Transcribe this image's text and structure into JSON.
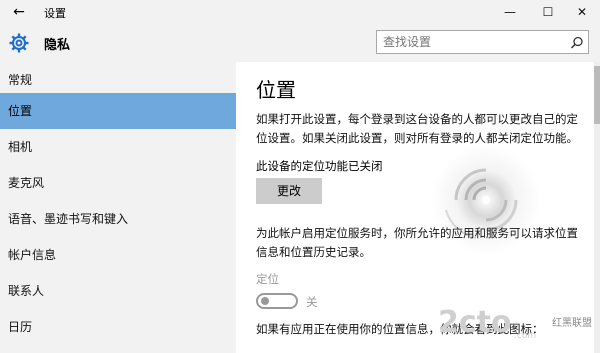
{
  "window": {
    "title": "设置",
    "back_icon": "back-arrow-icon",
    "controls": [
      "minimize-icon",
      "maximize-icon",
      "close-icon"
    ]
  },
  "header": {
    "section_title": "隐私",
    "search_placeholder": "查找设置"
  },
  "sidebar": {
    "items": [
      {
        "label": "常规",
        "active": false
      },
      {
        "label": "位置",
        "active": true
      },
      {
        "label": "相机",
        "active": false
      },
      {
        "label": "麦克风",
        "active": false
      },
      {
        "label": "语音、墨迹书写和键入",
        "active": false
      },
      {
        "label": "帐户信息",
        "active": false
      },
      {
        "label": "联系人",
        "active": false
      },
      {
        "label": "日历",
        "active": false
      }
    ]
  },
  "main": {
    "title": "位置",
    "intro": "如果打开此设置，每个登录到这台设备的人都可以更改自己的定位设置。如果关闭此设置，则对所有登录的人都关闭定位功能。",
    "device_status": "此设备的定位功能已关闭",
    "change_button": "更改",
    "account_text": "为此帐户启用定位服务时，你所允许的应用和服务可以请求位置信息和位置历史记录。",
    "location_label": "定位",
    "toggle_state_label": "关",
    "bottom_text": "如果有应用正在使用你的位置信息，你就会看到此图标："
  },
  "colors": {
    "accent": "#6fa8dc",
    "window_bg": "#f2f2f2",
    "content_bg": "#ffffff"
  },
  "watermark": {
    "text": "2cto",
    "sub": "红黑联盟",
    "suffix": ".com"
  }
}
